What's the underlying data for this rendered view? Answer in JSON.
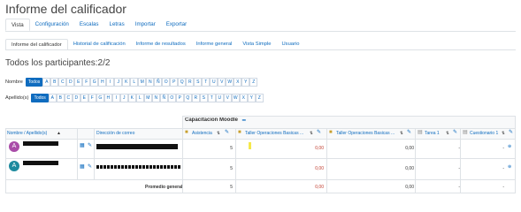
{
  "page": {
    "title": "Informe del calificador"
  },
  "tabs_main": [
    "Vista",
    "Configuración",
    "Escalas",
    "Letras",
    "Importar",
    "Exportar"
  ],
  "tabs_sub": [
    "Informe del calificador",
    "Historial de calificación",
    "Informe de resultados",
    "Informe general",
    "Vista Simple",
    "Usuario"
  ],
  "participants": {
    "label": "Todos los participantes:2/2"
  },
  "filters": {
    "nombre_label": "Nombre",
    "apellido_label": "Apellido(s)",
    "all_label": "Todos",
    "letters": [
      "A",
      "B",
      "C",
      "D",
      "E",
      "F",
      "G",
      "H",
      "I",
      "J",
      "K",
      "L",
      "M",
      "N",
      "Ñ",
      "O",
      "P",
      "Q",
      "R",
      "S",
      "T",
      "U",
      "V",
      "W",
      "X",
      "Y",
      "Z"
    ]
  },
  "grid": {
    "category": "Capacitacion Moodle",
    "category_icon": "minus-icon",
    "col_name": "Nombre / Apellido(s)",
    "col_email": "Dirección de correo",
    "items": [
      {
        "label": "Asistencia",
        "icon": "attendance-icon"
      },
      {
        "label": "Taller Operaciones Basicas ...",
        "icon": "workshop-icon"
      },
      {
        "label": "Taller Operaciones Basicas ...",
        "icon": "workshop-icon"
      },
      {
        "label": "Tarea 1",
        "icon": "assignment-icon"
      },
      {
        "label": "Cuestionario 1",
        "icon": "quiz-icon"
      }
    ],
    "rows": [
      {
        "avatar_letter": "A",
        "avatar_color": "#a94ca8",
        "values": [
          "5",
          "0,00",
          "0,00",
          "-",
          "-"
        ]
      },
      {
        "avatar_letter": "A",
        "avatar_color": "#1e8a9e",
        "values": [
          "5",
          "0,00",
          "0,00",
          "-",
          "-"
        ]
      }
    ],
    "average": {
      "label": "Promedio general",
      "values": [
        "5",
        "0,00",
        "0,00",
        "-",
        "-"
      ]
    }
  },
  "colors": {
    "link": "#0f6cbf",
    "grade_red": "#c0392b",
    "header_bg": "#e9ecef",
    "active_button": "#0f6cbf"
  }
}
